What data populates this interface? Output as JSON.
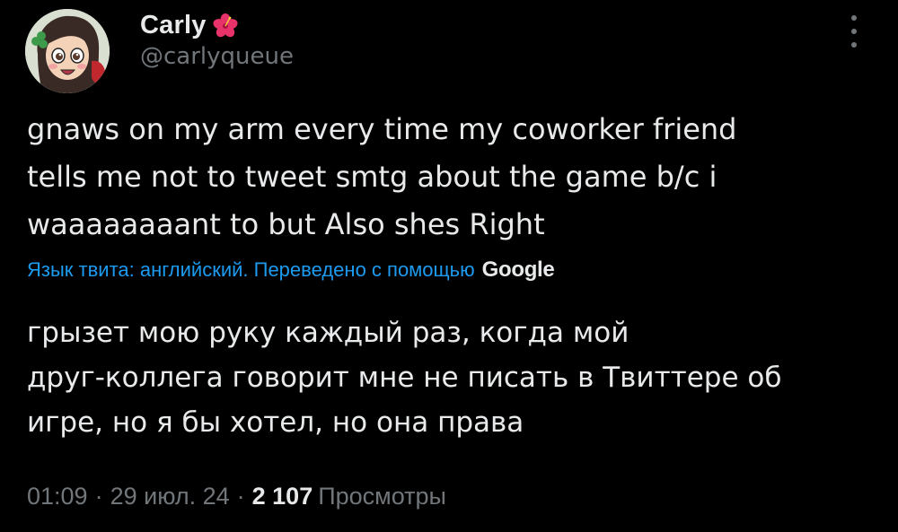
{
  "author": {
    "display_name": "Carly",
    "handle": "@carlyqueue",
    "name_emoji_icon": "hibiscus-icon",
    "avatar_icon": "cartoon-girl-avatar"
  },
  "tweet": {
    "text_lines": [
      "gnaws on my arm every time my coworker friend",
      "tells me not to tweet smtg about the game b/c i",
      "waaaaaaaant to but Also shes Right"
    ]
  },
  "translation": {
    "label": "Язык твита: английский. Переведено с помощью",
    "provider": "Google",
    "text_lines": [
      "грызет мою руку каждый раз, когда мой",
      "друг-коллега говорит мне не писать в Твиттере об",
      "игре, но я бы хотел, но она права"
    ]
  },
  "meta": {
    "time": "01:09",
    "separator": "·",
    "date": "29 июл. 24",
    "views_count": "2 107",
    "views_label": "Просмотры"
  },
  "menu": {
    "icon": "more-vertical-icon"
  },
  "colors": {
    "background": "#000000",
    "text_primary": "#e7e9ea",
    "text_secondary": "#71767b",
    "link": "#1d9bf0"
  }
}
